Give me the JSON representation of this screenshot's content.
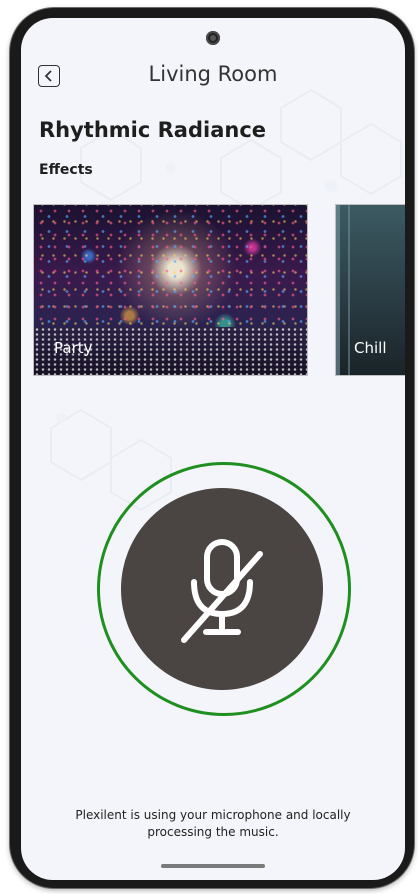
{
  "header": {
    "title": "Living Room",
    "back_icon": "chevron-left-icon"
  },
  "room": {
    "name": "Rhythmic Radiance"
  },
  "effects": {
    "label": "Effects",
    "items": [
      {
        "label": "Party"
      },
      {
        "label": "Chill"
      }
    ]
  },
  "microphone": {
    "icon": "microphone-off-icon",
    "state": "muted",
    "ring_color": "#1f8f1f",
    "button_color": "#4a4542"
  },
  "footer": {
    "line1": "Plexilent is using your microphone and locally",
    "line2": "processing the music."
  }
}
